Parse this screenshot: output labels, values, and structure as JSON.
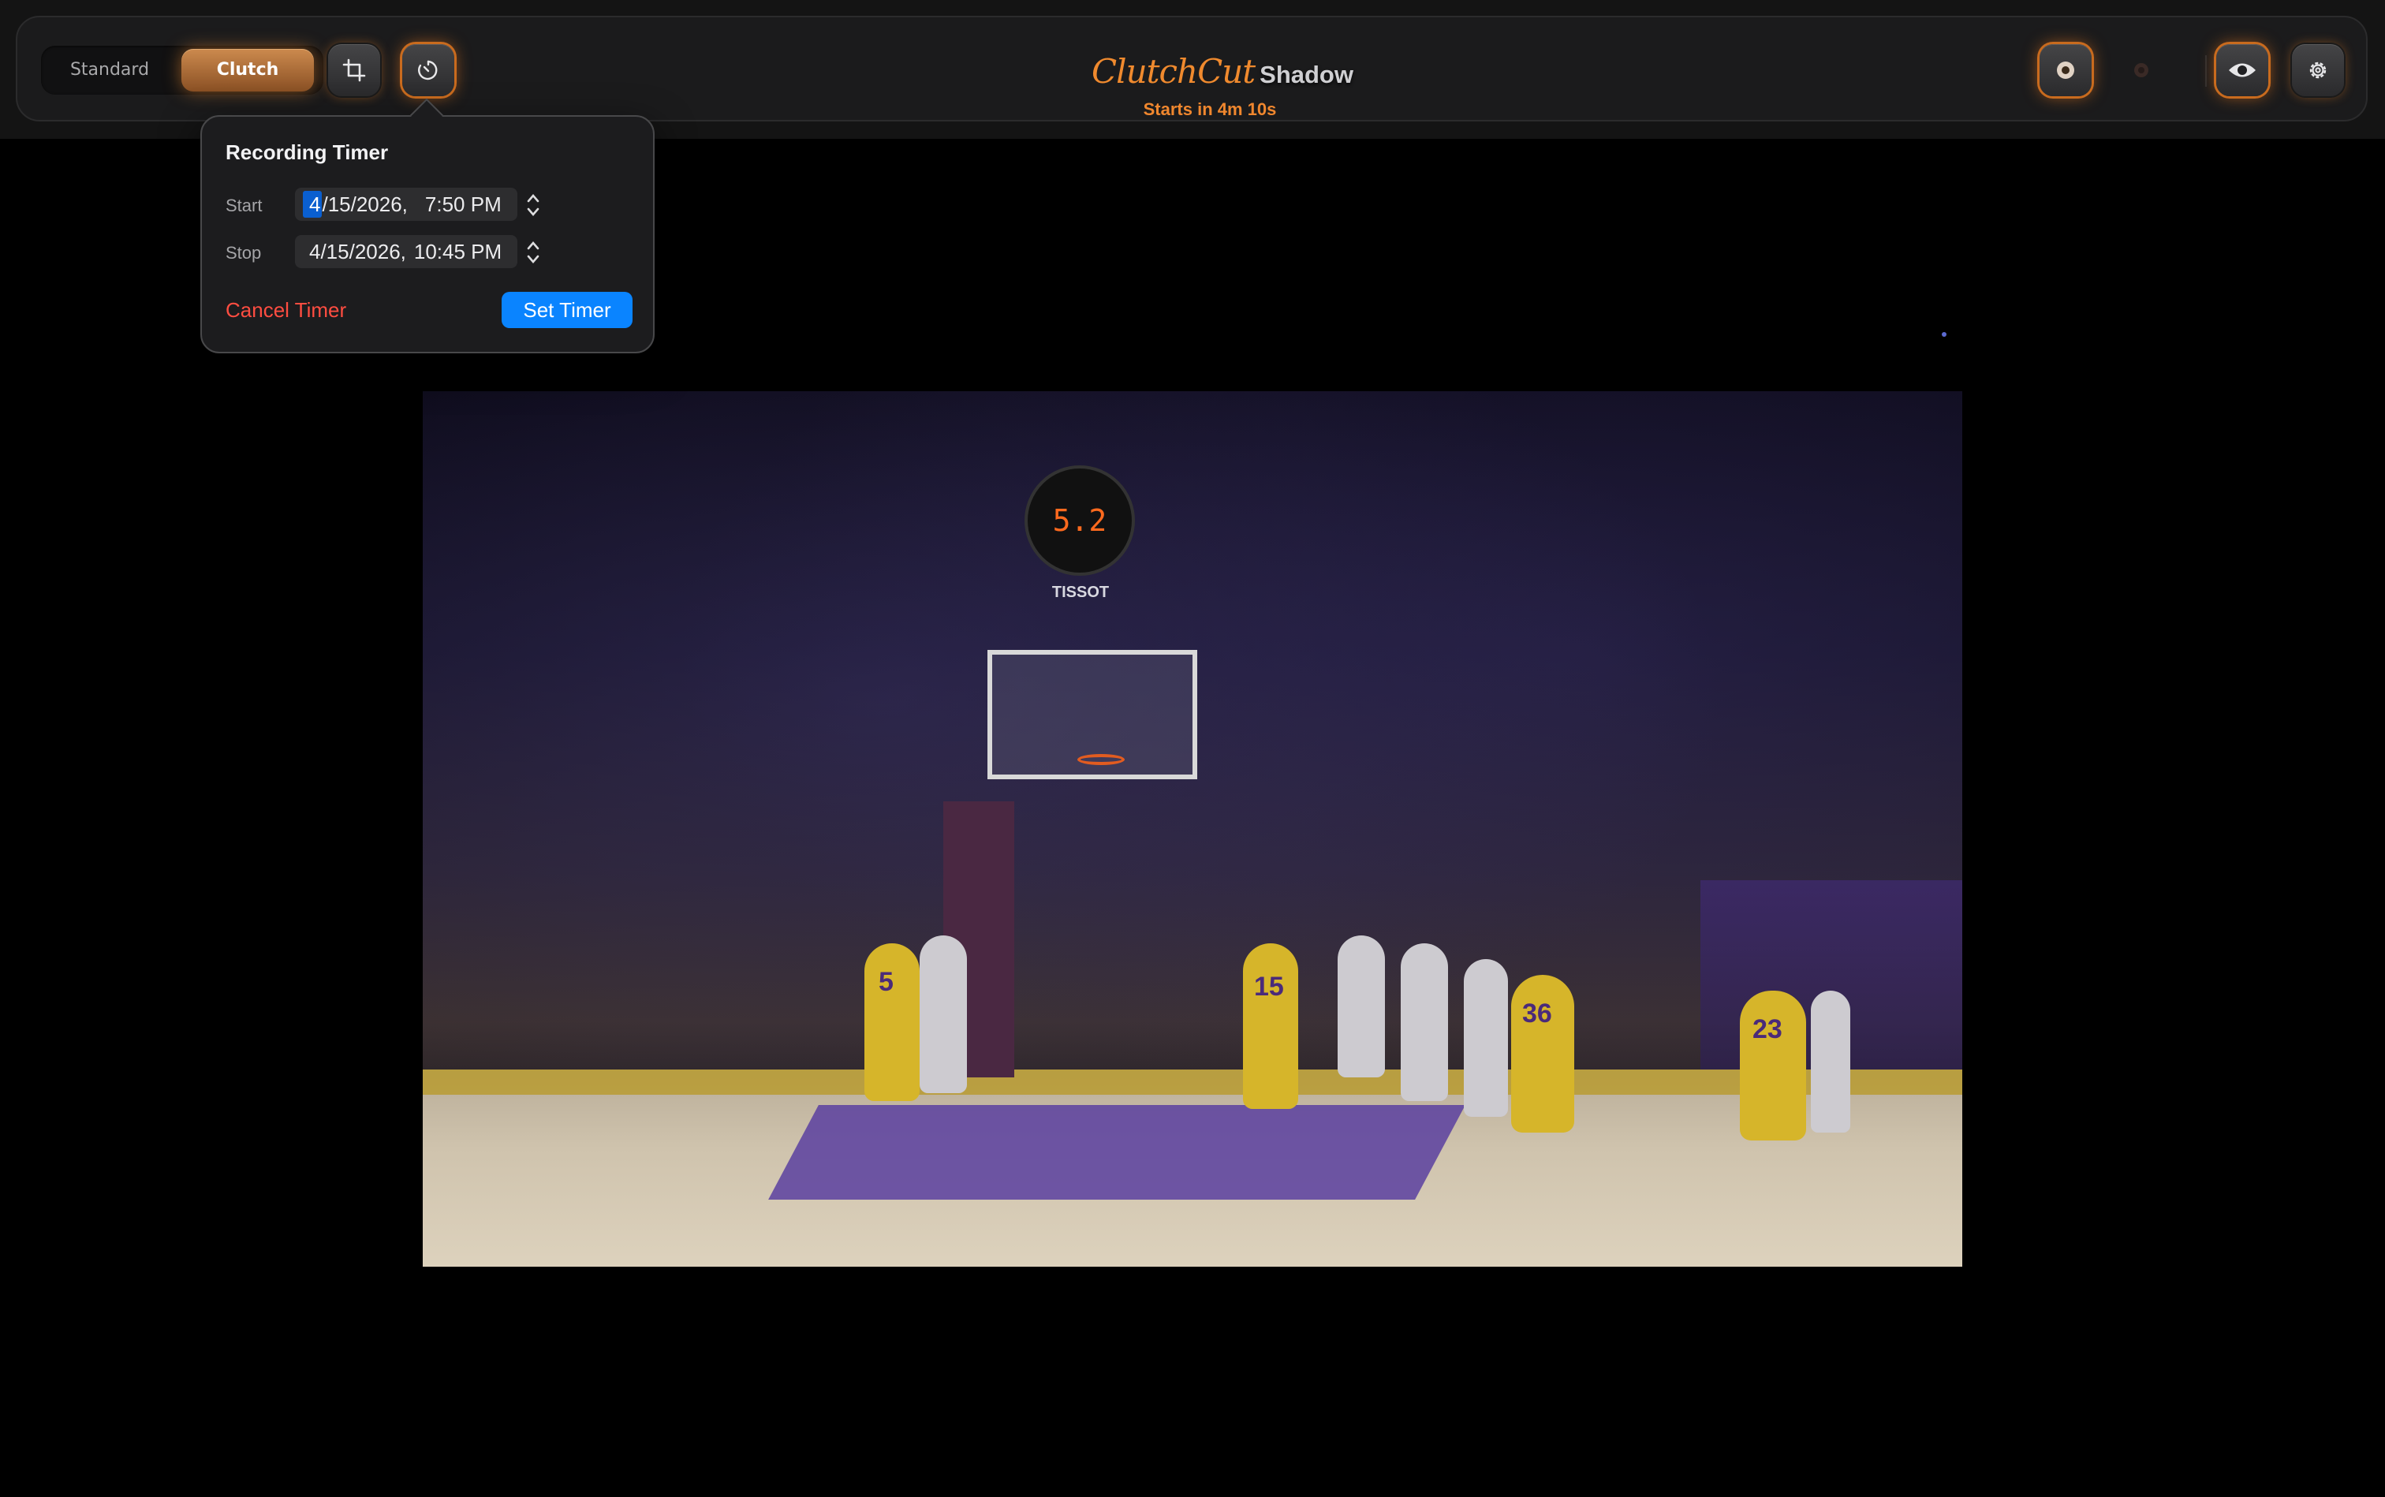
{
  "toolbar": {
    "mode_options": [
      "Standard",
      "Clutch"
    ],
    "selected_mode": "Clutch",
    "brand_script": "ClutchCut",
    "brand_name": "Shadow",
    "starts_in": "Starts in 4m 10s"
  },
  "icons": {
    "left": [
      "crop-icon",
      "timer-icon"
    ],
    "right": [
      "record-icon",
      "record-dim-icon",
      "eye-icon",
      "gear-icon"
    ]
  },
  "timer_popover": {
    "title": "Recording Timer",
    "start_label": "Start",
    "start_month": "4",
    "start_date_rest": "/15/2026,",
    "start_time": "7:50 PM",
    "stop_label": "Stop",
    "stop_date": "4/15/2026,",
    "stop_time": "10:45 PM",
    "cancel_label": "Cancel Timer",
    "set_label": "Set Timer"
  },
  "video": {
    "shot_clock": "5.2",
    "sponsor": "TISSOT",
    "jersey_numbers": [
      "5",
      "15",
      "36",
      "23"
    ]
  },
  "colors": {
    "accent_orange": "#f08a2e",
    "primary_blue": "#0a84ff",
    "destructive_red": "#ff4d41"
  }
}
